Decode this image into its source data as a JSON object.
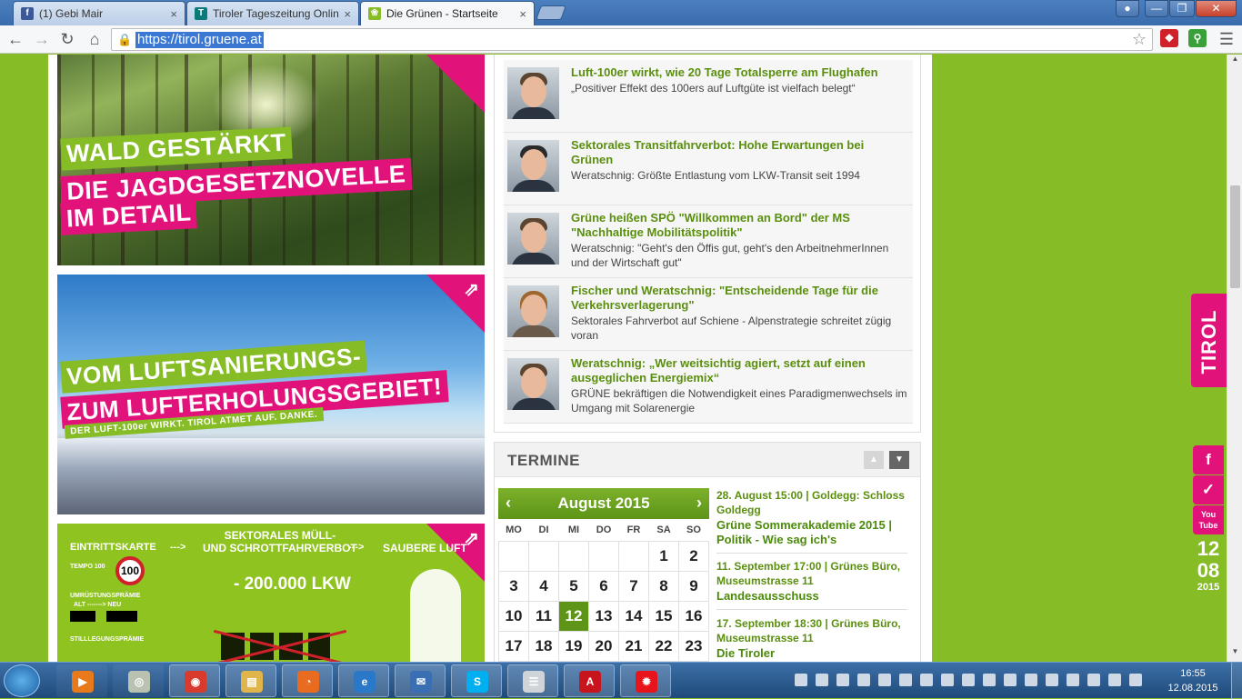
{
  "browser": {
    "tabs": [
      {
        "title": "(1) Gebi Mair",
        "icon": "facebook-icon",
        "color": "#3b5998",
        "glyph": "f"
      },
      {
        "title": "Tiroler Tageszeitung Onlin",
        "icon": "tt-icon",
        "color": "#0a7a7a",
        "glyph": "T"
      },
      {
        "title": "Die Grünen - Startseite",
        "icon": "gruene-icon",
        "color": "#86bc25",
        "glyph": "❀"
      }
    ],
    "url": "https://tirol.gruene.at",
    "close_glyph": "×"
  },
  "colors": {
    "brand_green": "#86bc25",
    "brand_pink": "#e2127b",
    "link_green": "#5a8f0e"
  },
  "banners": [
    {
      "lines": [
        "WALD GESTÄRKT",
        "DIE JAGDGESETZNOVELLE",
        "IM DETAIL"
      ]
    },
    {
      "lines": [
        "VOM LUFTSANIERUNGS-",
        "ZUM LUFTERHOLUNGSGEBIET!"
      ],
      "tagline": "DER LUFT-100er WIRKT. TIROL ATMET AUF. DANKE."
    },
    {
      "heading": "SEKTORALES MÜLL-\nUND SCHROTTFAHRVERBOT",
      "left": "EINTRITTSKARTE",
      "arrow1": "--->",
      "arrow2": "--->",
      "right": "SAUBERE LUFT",
      "tempo": "TEMPO 100",
      "speed": "100",
      "umr": "UMRÜSTUNGSPRÄMIE",
      "altneu": "ALT -------> NEU",
      "still": "STILLLEGUNGSPRÄMIE",
      "lkw": "- 200.000 LKW"
    }
  ],
  "news": [
    {
      "title": "Luft-100er wirkt, wie 20 Tage Totalsperre am Flughafen",
      "sub": "„Positiver Effekt des 100ers auf Luftgüte ist vielfach belegt“"
    },
    {
      "title": "Sektorales Transitfahrverbot: Hohe Erwartungen bei Grünen",
      "sub": "Weratschnig: Größte Entlastung vom LKW-Transit seit 1994"
    },
    {
      "title": "Grüne heißen SPÖ \"Willkommen an Bord\" der MS \"Nachhaltige Mobilitätspolitik\"",
      "sub": "Weratschnig: \"Geht's den Öffis gut, geht's den ArbeitnehmerInnen und der Wirtschaft gut\""
    },
    {
      "title": "Fischer und Weratschnig: \"Entscheidende Tage für die Verkehrsverlagerung\"",
      "sub": "Sektorales Fahrverbot auf Schiene - Alpenstrategie schreitet zügig voran"
    },
    {
      "title": "Weratschnig: „Wer weitsichtig agiert, setzt auf einen ausgeglichen Energiemix“",
      "sub": "GRÜNE bekräftigen die Notwendigkeit eines Paradigmenwechsels im Umgang mit Solarenergie"
    }
  ],
  "termine": {
    "heading": "TERMINE",
    "calendar": {
      "month": "August 2015",
      "weekdays": [
        "MO",
        "DI",
        "MI",
        "DO",
        "FR",
        "SA",
        "SO"
      ],
      "weeks": [
        [
          "",
          "",
          "",
          "",
          "",
          "1",
          "2"
        ],
        [
          "3",
          "4",
          "5",
          "6",
          "7",
          "8",
          "9"
        ],
        [
          "10",
          "11",
          "12",
          "13",
          "14",
          "15",
          "16"
        ],
        [
          "17",
          "18",
          "19",
          "20",
          "21",
          "22",
          "23"
        ]
      ],
      "today": "12"
    },
    "events": [
      {
        "date": "28. August 15:00 | Goldegg: Schloss Goldegg",
        "name": "Grüne Sommerakademie 2015 | Politik - Wie sag ich's"
      },
      {
        "date": "11. September 17:00 | Grünes Büro, Museumstrasse 11",
        "name": "Landesausschuss"
      },
      {
        "date": "17. September 18:30 | Grünes Büro, Museumstrasse 11",
        "name": "Die Tiroler"
      }
    ]
  },
  "side": {
    "tirol": "TIROL",
    "social": [
      {
        "icon": "facebook-icon",
        "glyph": "f"
      },
      {
        "icon": "twitter-icon",
        "glyph": "t"
      },
      {
        "icon": "youtube-icon",
        "glyph": "You\nTube"
      }
    ],
    "date": {
      "day": "12",
      "month": "08",
      "year": "2015"
    }
  },
  "taskbar": {
    "apps": [
      {
        "icon": "media-player-icon",
        "color": "#e87a1c",
        "glyph": "▶"
      },
      {
        "icon": "dvd-icon",
        "color": "#b9c2b0",
        "glyph": "◎"
      },
      {
        "icon": "chrome-icon",
        "color": "#d83b2d",
        "glyph": "◉"
      },
      {
        "icon": "explorer-folder-icon",
        "color": "#e0b64c",
        "glyph": "▤"
      },
      {
        "icon": "firefox-icon",
        "color": "#e86b1f",
        "glyph": "◔"
      },
      {
        "icon": "internet-explorer-icon",
        "color": "#2a78c8",
        "glyph": "e"
      },
      {
        "icon": "thunderbird-icon",
        "color": "#3b6fb3",
        "glyph": "✉"
      },
      {
        "icon": "skype-icon",
        "color": "#00aff0",
        "glyph": "S"
      },
      {
        "icon": "document-icon",
        "color": "#cfd4d9",
        "glyph": "☰"
      },
      {
        "icon": "acrobat-icon",
        "color": "#c8141c",
        "glyph": "A"
      },
      {
        "icon": "paint-splash-icon",
        "color": "#e8141c",
        "glyph": "✹"
      }
    ],
    "clock_time": "16:55",
    "clock_date": "12.08.2015"
  }
}
